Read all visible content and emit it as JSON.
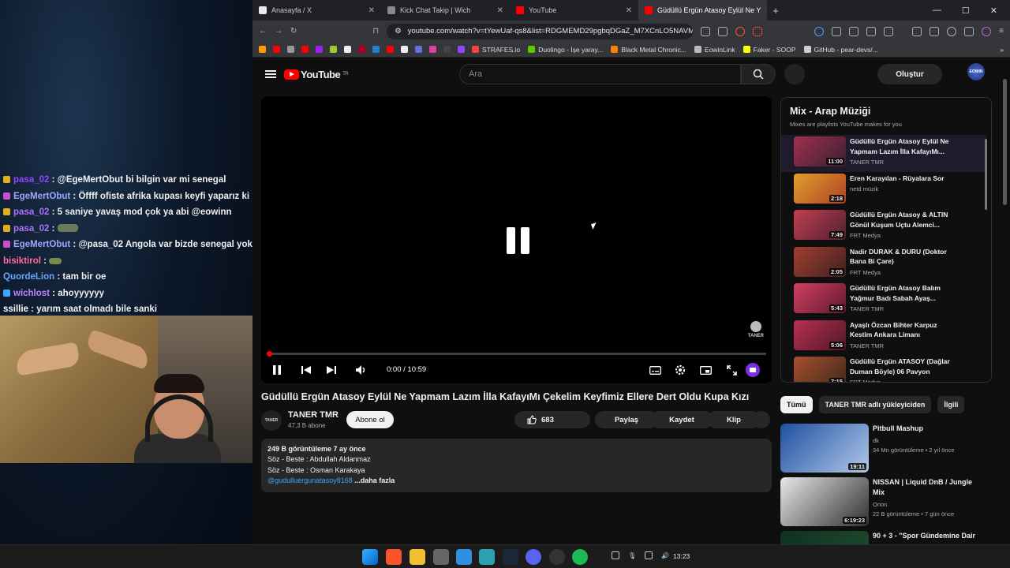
{
  "chat": [
    {
      "user": "pasa_02",
      "msg": "@EgeMertObut bi bilgin var mi senegal",
      "ucolor": "#9147ff",
      "badge": "#e0b020"
    },
    {
      "user": "EgeMertObut",
      "msg": "Öffff ofiste afrika kupası keyfi yaparız ki",
      "ucolor": "#9da8ff",
      "badge": "#c94fd0"
    },
    {
      "user": "pasa_02",
      "msg": "5 saniye yavaş mod çok ya abi @eowinn",
      "ucolor": "#b072ff",
      "badge": "#e0b020"
    },
    {
      "user": "pasa_02",
      "msg": "",
      "ucolor": "#b072ff",
      "badge": "#e0b020",
      "emote": true
    },
    {
      "user": "EgeMertObut",
      "msg": "@pasa_02 Angola var bizde senegal yok",
      "ucolor": "#9da8ff",
      "badge": "#c94fd0"
    },
    {
      "user": "bisiktirol",
      "msg": "",
      "ucolor": "#ff6b9a",
      "badge": "",
      "emote": "small"
    },
    {
      "user": "QuordeLion",
      "msg": "tam bir oe",
      "ucolor": "#6aa6ff",
      "badge": ""
    },
    {
      "user": "wichlost",
      "msg": "ahoyyyyyy",
      "ucolor": "#c680ff",
      "badge": "#3ea6ff"
    },
    {
      "user": "ssillie",
      "msg": "yarım saat olmadı bile sanki",
      "ucolor": "#ffffff",
      "badge": ""
    }
  ],
  "browser": {
    "tabs": [
      {
        "label": "Anasayfa / X",
        "color": "#e8e8e8"
      },
      {
        "label": "Kick Chat Takip | Wich",
        "color": "#888888"
      },
      {
        "label": "YouTube",
        "color": "#ff0000"
      },
      {
        "label": "Güdüllü Ergün Atasoy Eylül Ne Y",
        "color": "#ff0000"
      }
    ],
    "url": "youtube.com/watch?v=tYewUaf-qs8&list=RDGMEMD29pgbqDGaZ_M7XCnLO5NAVMtY...",
    "bookmarks": [
      "STRAFES.io",
      "Duolingo - İşe yaray...",
      "Black Metal Chronic...",
      "EowinLink",
      "Faker - SOOP",
      "GitHub - pear-devs/..."
    ]
  },
  "yt": {
    "logo": "YouTube",
    "region": "TR",
    "search_placeholder": "Ara",
    "create_label": "Oluştur",
    "avatar_text": "EOWIN",
    "time": "0:00 / 10:59",
    "progress_fraction": 0.0,
    "watermark": "TANER",
    "title": "Güdüllü Ergün Atasoy Eylül Ne Yapmam Lazım İlla KafayıMı Çekelim Keyfimiz Ellere Dert Oldu Kupa Kızı",
    "channel": "TANER TMR",
    "channel_icon_text": "TANER",
    "subs": "47,3 B abone",
    "subscribe": "Abone ol",
    "likes": "683",
    "share": "Paylaş",
    "save": "Kaydet",
    "clip": "Klip",
    "desc": {
      "stats": "249 B görüntüleme  7 ay önce",
      "line1": "Söz - Beste : Abdullah Aldanmaz",
      "line2": "Söz - Beste : Osman Karakaya",
      "link": "@gudulluergunatasoy8168",
      "more": "...daha fazla"
    },
    "playlist": {
      "title": "Mix - Arap Müziği",
      "subtitle": "Mixes are playlists YouTube makes for you",
      "items": [
        {
          "title": "Güdüllü Ergün Atasoy Eylül Ne Yapmam Lazım İlla KafayıMı...",
          "channel": "TANER TMR",
          "dur": "11:00",
          "c1": "#a03050",
          "c2": "#3a2030"
        },
        {
          "title": "Eren Karayılan - Rüyalara Sor",
          "channel": "netd müzik",
          "dur": "2:18",
          "c1": "#e0a030",
          "c2": "#b04020"
        },
        {
          "title": "Güdüllü Ergün Atasoy & ALTIN Gönül Kuşum Uçtu Alemci...",
          "channel": "FRT Medya",
          "dur": "7:49",
          "c1": "#c04050",
          "c2": "#502030"
        },
        {
          "title": "Nadir DURAK & DURU (Doktor Bana Bi Çare)",
          "channel": "FRT Medya",
          "dur": "2:05",
          "c1": "#a04030",
          "c2": "#402020"
        },
        {
          "title": "Güdüllü Ergün Atasoy Balım Yağmur Badı Sabah Ayaş...",
          "channel": "TANER TMR",
          "dur": "5:43",
          "c1": "#d04060",
          "c2": "#601830"
        },
        {
          "title": "Ayaşlı Özcan Bihter Karpuz Kestim Ankara Limanı",
          "channel": "TANER TMR",
          "dur": "5:06",
          "c1": "#b83050",
          "c2": "#501828"
        },
        {
          "title": "Güdüllü Ergün ATASOY (Dağlar Duman Böyle) 06 Pavyon",
          "channel": "FRT Medya",
          "dur": "7:15",
          "c1": "#a85030",
          "c2": "#402818"
        }
      ]
    },
    "chips": [
      "Tümü",
      "TANER TMR adlı yükleyiciden",
      "İlgili"
    ],
    "recs": [
      {
        "title": "Pitbull Mashup",
        "channel": "dk",
        "meta": "34 Mn görüntüleme • 2 yıl önce",
        "dur": "19:11",
        "c1": "#2050a0",
        "c2": "#b0c8e8"
      },
      {
        "title": "NISSAN | Liquid DnB / Jungle Mix",
        "channel": "Orion",
        "meta": "22 B görüntüleme • 7 gün önce",
        "dur": "6:19:23",
        "c1": "#e8e8e8",
        "c2": "#303030"
      },
      {
        "title": "90 + 3 - \"Spor Gündemine Dair",
        "channel": "",
        "meta": "",
        "dur": "",
        "c1": "#103020",
        "c2": "#205030"
      }
    ]
  },
  "taskbar": {
    "clock": "13:23"
  }
}
